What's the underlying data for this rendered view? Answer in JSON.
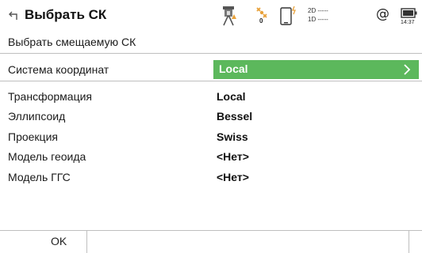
{
  "header": {
    "title": "Выбрать СК",
    "sat_count": "0",
    "precision_2d": "2D -----",
    "precision_1d": "1D -----",
    "at_symbol": "@",
    "clock": "14:37"
  },
  "subheader": {
    "text": "Выбрать смещаемую СК"
  },
  "coordinate_system": {
    "label": "Система координат",
    "value": "Local"
  },
  "properties": [
    {
      "label": "Трансформация",
      "value": "Local"
    },
    {
      "label": "Эллипсоид",
      "value": "Bessel"
    },
    {
      "label": "Проекция",
      "value": "Swiss"
    },
    {
      "label": "Модель геоида",
      "value": "<Нет>"
    },
    {
      "label": "Модель ГГС",
      "value": "<Нет>"
    }
  ],
  "footer": {
    "ok_label": "OK"
  },
  "icons": {
    "back": "back-arrow-icon",
    "instrument": "total-station-icon",
    "satellites": "satellite-icon",
    "device": "controller-device-icon",
    "battery": "battery-icon",
    "chevron": "chevron-right-icon"
  },
  "colors": {
    "accent": "#5cb85c",
    "instrument_warning": "#e8a13a"
  }
}
